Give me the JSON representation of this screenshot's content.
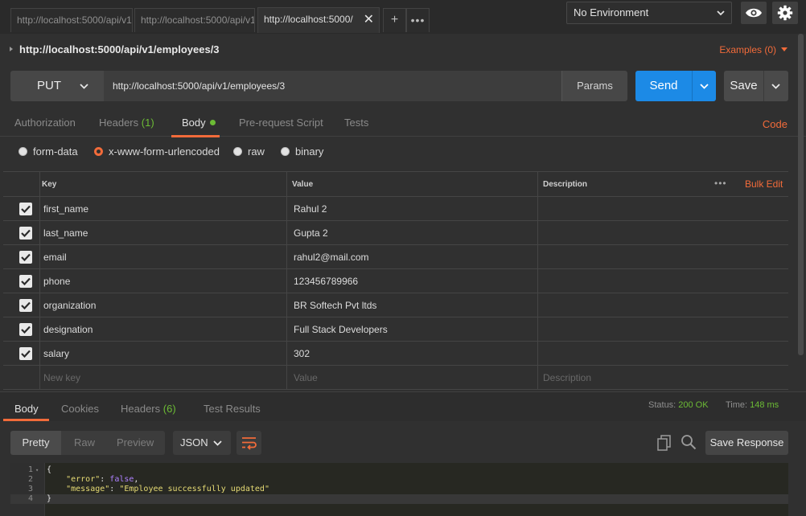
{
  "tabs": [
    {
      "label": "http://localhost:5000/api/v1",
      "active": false
    },
    {
      "label": "http://localhost:5000/api/v1",
      "active": false
    },
    {
      "label": "http://localhost:5000/",
      "active": true
    }
  ],
  "tab_close_glyph": "✕",
  "tab_add_glyph": "+",
  "tab_more_glyph": "•••",
  "environment": {
    "selected": "No Environment"
  },
  "request": {
    "title": "http://localhost:5000/api/v1/employees/3",
    "examples_label": "Examples (0)",
    "method": "PUT",
    "url": "http://localhost:5000/api/v1/employees/3",
    "params_label": "Params",
    "send_label": "Send",
    "save_label": "Save"
  },
  "request_tabs": {
    "authorization": "Authorization",
    "headers": "Headers",
    "headers_count": "(1)",
    "body": "Body",
    "prerequest": "Pre-request Script",
    "tests": "Tests",
    "code": "Code"
  },
  "body_types": {
    "form_data": "form-data",
    "urlencoded": "x-www-form-urlencoded",
    "raw": "raw",
    "binary": "binary",
    "selected": "x-www-form-urlencoded"
  },
  "kv_table": {
    "headers": {
      "key": "Key",
      "value": "Value",
      "description": "Description"
    },
    "more_glyph": "•••",
    "bulk_edit": "Bulk Edit",
    "rows": [
      {
        "key": "first_name",
        "value": "Rahul 2",
        "checked": true
      },
      {
        "key": "last_name",
        "value": "Gupta 2",
        "checked": true
      },
      {
        "key": "email",
        "value": "rahul2@mail.com",
        "checked": true
      },
      {
        "key": "phone",
        "value": "123456789966",
        "checked": true
      },
      {
        "key": "organization",
        "value": "BR Softech Pvt ltds",
        "checked": true
      },
      {
        "key": "designation",
        "value": "Full Stack Developers",
        "checked": true
      },
      {
        "key": "salary",
        "value": "302",
        "checked": true
      }
    ],
    "placeholder": {
      "key": "New key",
      "value": "Value",
      "description": "Description"
    }
  },
  "response": {
    "tabs": {
      "body": "Body",
      "cookies": "Cookies",
      "headers": "Headers",
      "headers_count": "(6)",
      "test_results": "Test Results"
    },
    "status_label": "Status:",
    "status_value": "200 OK",
    "time_label": "Time:",
    "time_value": "148 ms",
    "view_modes": {
      "pretty": "Pretty",
      "raw": "Raw",
      "preview": "Preview"
    },
    "format": "JSON",
    "save_response": "Save Response",
    "code_lines": [
      {
        "n": "1",
        "fold": "▾",
        "parts": [
          {
            "t": "{",
            "c": ""
          }
        ]
      },
      {
        "n": "2",
        "fold": "",
        "parts": [
          {
            "t": "    ",
            "c": ""
          },
          {
            "t": "\"error\"",
            "c": "tok-key"
          },
          {
            "t": ": ",
            "c": ""
          },
          {
            "t": "false",
            "c": "tok-bool"
          },
          {
            "t": ",",
            "c": ""
          }
        ]
      },
      {
        "n": "3",
        "fold": "",
        "parts": [
          {
            "t": "    ",
            "c": ""
          },
          {
            "t": "\"message\"",
            "c": "tok-key"
          },
          {
            "t": ": ",
            "c": ""
          },
          {
            "t": "\"Employee successfully updated\"",
            "c": "tok-str"
          }
        ]
      },
      {
        "n": "4",
        "fold": "",
        "parts": [
          {
            "t": "}",
            "c": ""
          }
        ]
      }
    ]
  },
  "colors": {
    "accent": "#f26b3a",
    "send_blue": "#1c8ae6",
    "success_green": "#6cbb35",
    "background": "#303030"
  },
  "icons": [
    "chevron-down-icon",
    "eye-icon",
    "gear-icon",
    "close-icon",
    "plus-icon",
    "more-icon",
    "checkbox-icon",
    "wrap-lines-icon",
    "copy-icon",
    "search-icon"
  ]
}
